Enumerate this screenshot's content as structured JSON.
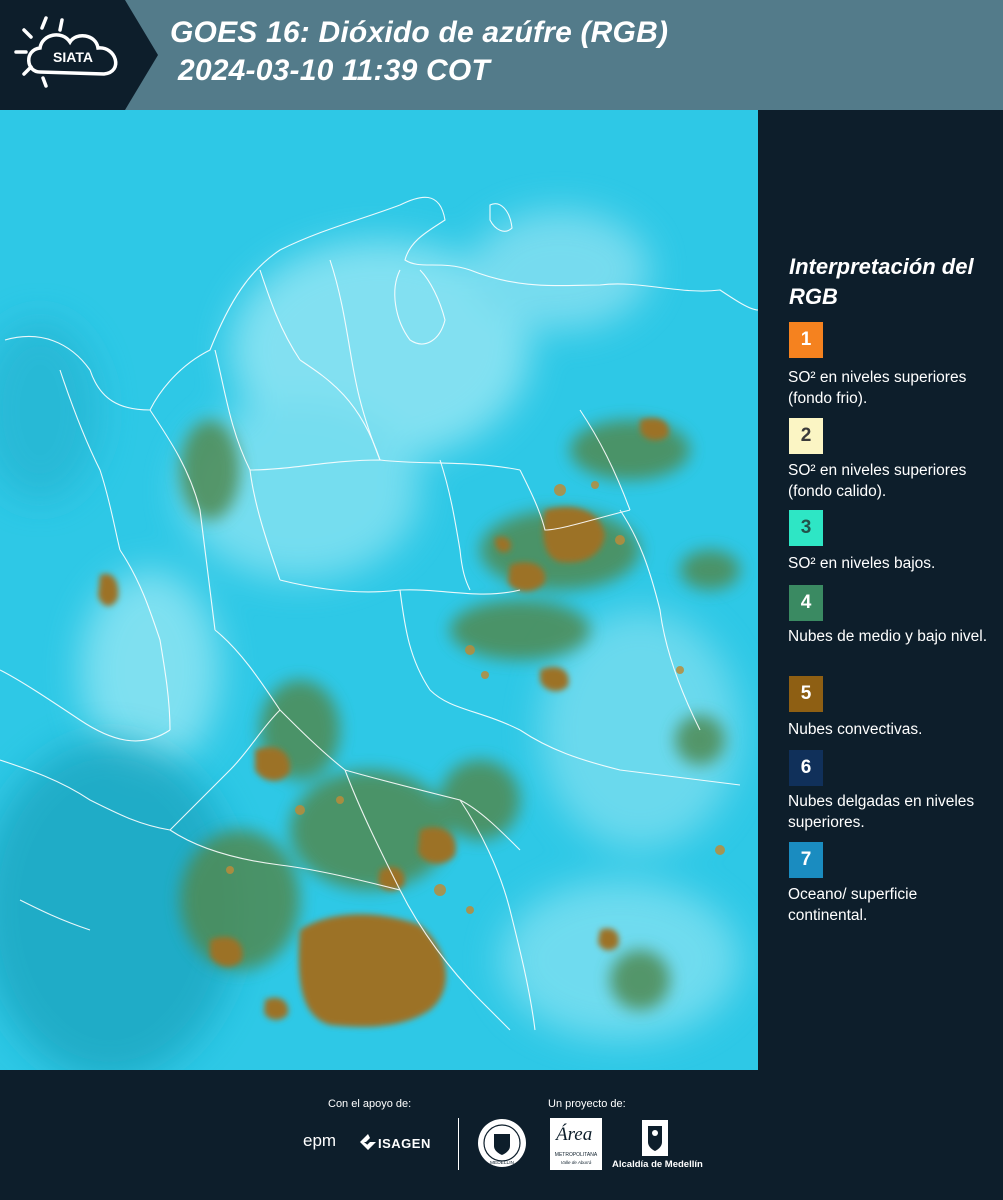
{
  "header": {
    "logo_text": "SIATA",
    "title_line1": "GOES 16: Dióxido de azúfre (RGB)",
    "title_line2": "2024-03-10 11:39 COT"
  },
  "colors": {
    "header_bg": "#537b8a",
    "page_bg": "#0d1e2b",
    "map_background": "#2ec8e6",
    "cloud_brown": "#9c7228",
    "cloud_green": "#4f8a52",
    "border_lines": "#ffffff"
  },
  "legend": {
    "title": "Interpretación del RGB",
    "items": [
      {
        "number": "1",
        "color": "#f5821f",
        "number_color": "#ffffff",
        "text": "SO² en niveles superiores (fondo frio)."
      },
      {
        "number": "2",
        "color": "#fbf5c4",
        "number_color": "#3a3a3a",
        "text": "SO² en niveles superiores (fondo calido)."
      },
      {
        "number": "3",
        "color": "#2ee6c5",
        "number_color": "#22524a",
        "text": "SO² en niveles bajos."
      },
      {
        "number": "4",
        "color": "#3a8a62",
        "number_color": "#ffffff",
        "text": "Nubes de medio y bajo nivel."
      },
      {
        "number": "5",
        "color": "#8e5f13",
        "number_color": "#ffffff",
        "text": "Nubes convectivas."
      },
      {
        "number": "6",
        "color": "#10305a",
        "number_color": "#ffffff",
        "text": "Nubes delgadas en niveles superiores."
      },
      {
        "number": "7",
        "color": "#1a8cc0",
        "number_color": "#ffffff",
        "text": "Oceano/ superficie continental."
      }
    ]
  },
  "footer": {
    "support_label": "Con el apoyo de:",
    "project_label": "Un proyecto de:",
    "logos": {
      "epm": "epm",
      "isagen": "ISAGEN",
      "area_metropolitana": "Área",
      "area_subtitle": "METROPOLITANA",
      "area_subtitle2": "Valle de Aburrá",
      "medellin_seal": "MEDELLIN",
      "alcaldia": "Alcaldía de Medellín"
    }
  }
}
